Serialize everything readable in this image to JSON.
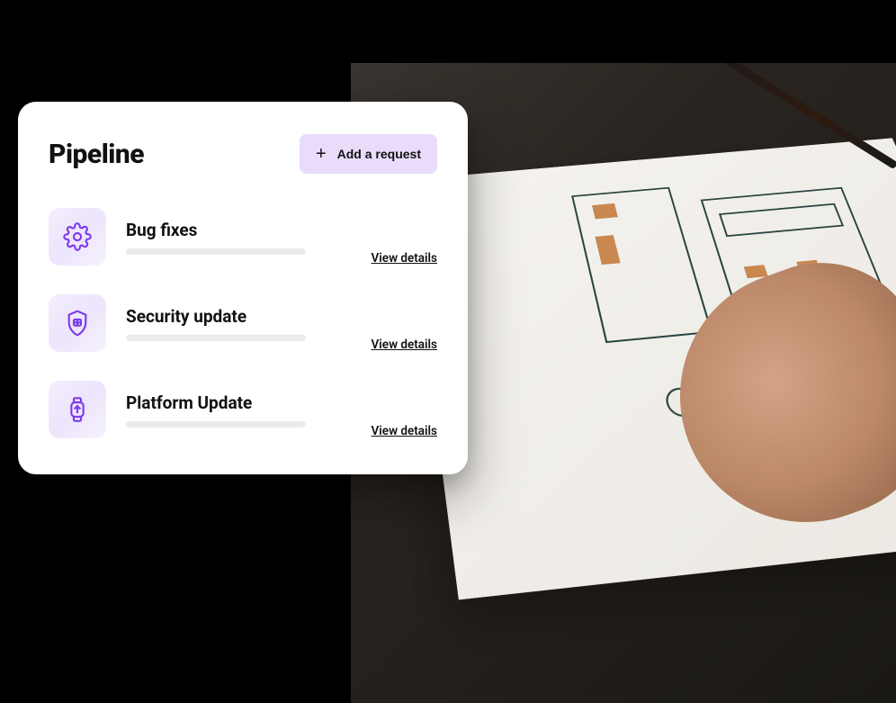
{
  "card": {
    "title": "Pipeline",
    "add_button_label": "Add a request",
    "view_details_label": "View details",
    "items": [
      {
        "title": "Bug fixes",
        "icon": "gear-icon"
      },
      {
        "title": "Security update",
        "icon": "shield-icon"
      },
      {
        "title": "Platform Update",
        "icon": "watch-upload-icon"
      }
    ]
  }
}
